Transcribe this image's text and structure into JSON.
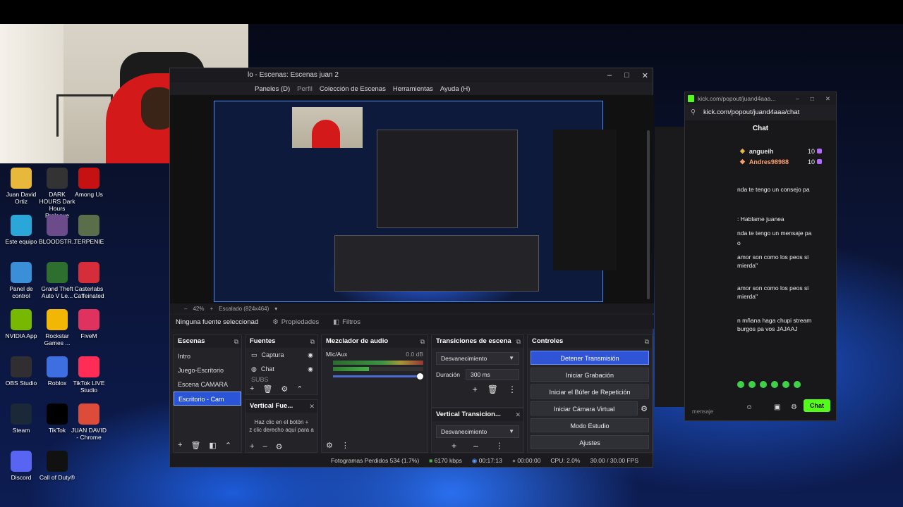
{
  "obs": {
    "title": "lo - Escenas: Escenas juan 2",
    "window_controls": [
      "–",
      "□",
      "✕"
    ],
    "menu": [
      {
        "label": "Paneles (D)",
        "dim": false
      },
      {
        "label": "Perfil",
        "dim": true
      },
      {
        "label": "Colección de Escenas",
        "dim": false
      },
      {
        "label": "Herramientas",
        "dim": false
      },
      {
        "label": "Ayuda (H)",
        "dim": false
      }
    ],
    "zoom_label": "42%",
    "scale_label": "Escalado (824x464)",
    "source_bar": {
      "selected": "Ninguna fuente seleccionad",
      "properties": "Propiedades",
      "filters": "Filtros"
    },
    "scenes": {
      "title": "Escenas",
      "items": [
        "Intro",
        "Juego-Escritorio",
        "Escena CAMARA",
        "Escritorio - Cam"
      ],
      "selected_index": 3
    },
    "sources": {
      "title": "Fuentes",
      "items": [
        "Captura",
        "Chat",
        "SUBS"
      ]
    },
    "vertical_sources": {
      "title": "Vertical Fue...",
      "hint_line1": "Haz clic en el botón +",
      "hint_line2": "z clic derecho aquí para a"
    },
    "mixer": {
      "title": "Mezclador de audio",
      "channel": "Mic/Aux",
      "db": "0.0 dB"
    },
    "transitions": {
      "title": "Transiciones de escena",
      "selected": "Desvanecimiento",
      "duration_label": "Duración",
      "duration_value": "300 ms"
    },
    "vertical_transitions": {
      "title": "Vertical Transicion...",
      "selected": "Desvanecimiento"
    },
    "controls": {
      "title": "Controles",
      "buttons": [
        "Detener Transmisión",
        "Iniciar Grabación",
        "Iniciar el Búfer de Repetición",
        "Iniciar Cámara Virtual",
        "Modo Estudio",
        "Ajustes"
      ]
    },
    "status": {
      "dropped": "Fotogramas Perdidos 534 (1.7%)",
      "bitrate": "6170 kbps",
      "live_time": "00:17:13",
      "rec_time": "00:00:00",
      "cpu": "CPU: 2.0%",
      "fps": "30.00 / 30.00 FPS"
    }
  },
  "desktop_icons": [
    {
      "label": "Juan David Ortiz",
      "icon": "folder-icon",
      "color": "#e8b83a"
    },
    {
      "label": "DARK HOURS Dark Hours Prologue",
      "icon": "game-icon",
      "color": "#333333"
    },
    {
      "label": "Among Us",
      "icon": "amongus-icon",
      "color": "#c51111"
    },
    {
      "label": "Este equipo",
      "icon": "computer-icon",
      "color": "#2aa7d8"
    },
    {
      "label": "BLOODSTR...",
      "icon": "game-icon",
      "color": "#6b4b8a"
    },
    {
      "label": "TERPENIE",
      "icon": "game-icon",
      "color": "#5a6e4a"
    },
    {
      "label": "Panel de control",
      "icon": "control-panel-icon",
      "color": "#3b8ed8"
    },
    {
      "label": "Grand Theft Auto V Le...",
      "icon": "gta-icon",
      "color": "#2e6e2e"
    },
    {
      "label": "Casterlabs Caffeinated",
      "icon": "casterlabs-icon",
      "color": "#d62d3b"
    },
    {
      "label": "NVIDIA App",
      "icon": "nvidia-icon",
      "color": "#76b900"
    },
    {
      "label": "Rockstar Games ...",
      "icon": "rockstar-icon",
      "color": "#f2b705"
    },
    {
      "label": "FiveM",
      "icon": "fivem-icon",
      "color": "#e0325f"
    },
    {
      "label": "OBS Studio",
      "icon": "obs-icon",
      "color": "#302e31"
    },
    {
      "label": "Roblox",
      "icon": "roblox-icon",
      "color": "#3d6fe0"
    },
    {
      "label": "TikTok LIVE Studio",
      "icon": "tiktok-live-icon",
      "color": "#ff2c55"
    },
    {
      "label": "Steam",
      "icon": "steam-icon",
      "color": "#1b2838"
    },
    {
      "label": "TikTok",
      "icon": "tiktok-icon",
      "color": "#000000"
    },
    {
      "label": "JUAN DAVID - Chrome",
      "icon": "chrome-icon",
      "color": "#dd4b39"
    },
    {
      "label": "Discord",
      "icon": "discord-icon",
      "color": "#5865f2"
    },
    {
      "label": "Call of Duty®",
      "icon": "cod-icon",
      "color": "#111111"
    }
  ],
  "chat": {
    "tab_title": "kick.com/popout/juand4aaa...",
    "url": "kick.com/popout/juand4aaa/chat",
    "header": "Chat",
    "users": [
      {
        "name": "angueih",
        "count": "10",
        "color": "#ffffff"
      },
      {
        "name": "Andres98988",
        "count": "10",
        "color": "#ff9f6b"
      }
    ],
    "messages": [
      "nda te tengo un consejo pa",
      ": Hablame juanea",
      "nda te tengo un mensaje pa",
      "o",
      "amor son como los peos si",
      "mierda\"",
      "amor son como los peos si",
      "mierda\"",
      "n mñana haga chupi stream",
      "burgos pa vos JAJAAJ"
    ],
    "send_label": "Chat",
    "footer_hint": "mensaje"
  }
}
